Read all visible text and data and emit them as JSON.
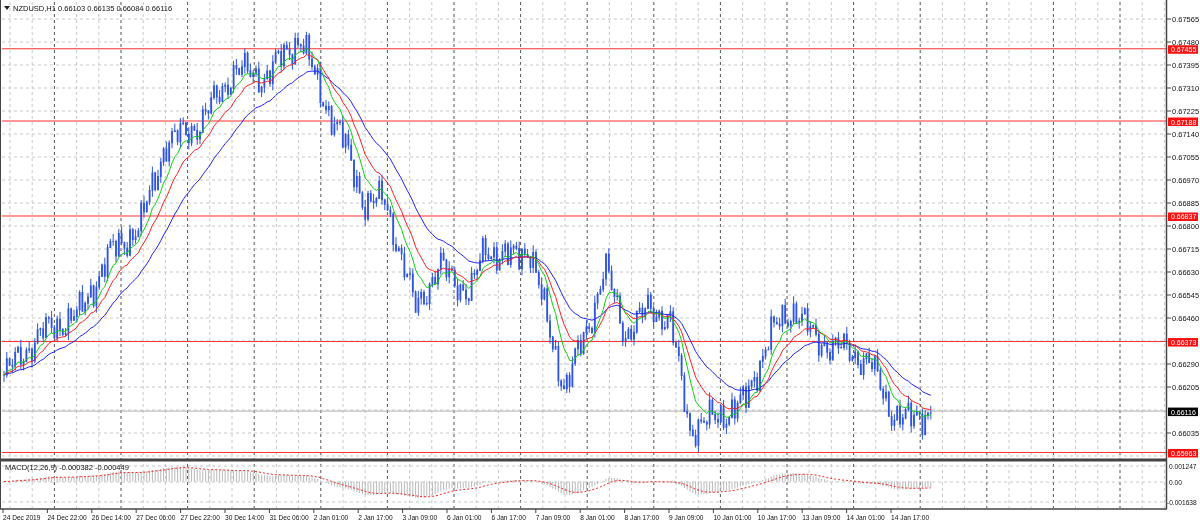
{
  "chart": {
    "symbol": "NZDUSD,H1",
    "ohlc": [
      "0.66103",
      "0.66135",
      "0.66084",
      "0.66116"
    ]
  },
  "price_axis_ticks": [
    "0.67565",
    "0.67480",
    "0.67395",
    "0.67310",
    "0.67225",
    "0.67140",
    "0.67055",
    "0.66970",
    "0.66885",
    "0.66800",
    "0.66715",
    "0.66630",
    "0.66545",
    "0.66460",
    "0.66290",
    "0.66205",
    "0.66035"
  ],
  "price_levels": [
    {
      "label": "0.67455"
    },
    {
      "label": "0.67188"
    },
    {
      "label": "0.66837"
    },
    {
      "label": "0.66373"
    },
    {
      "label": "0.65963"
    }
  ],
  "current_price": "0.66116",
  "time_axis_labels": [
    "24 Dec 2019",
    "24 Dec 22:00",
    "26 Dec 14:00",
    "27 Dec 06:00",
    "27 Dec 22:00",
    "30 Dec 14:00",
    "31 Dec 06:00",
    "2 Jan 01:00",
    "2 Jan 17:00",
    "3 Jan 09:00",
    "6 Jan 01:00",
    "6 Jan 17:00",
    "7 Jan 09:00",
    "8 Jan 01:00",
    "8 Jan 17:00",
    "9 Jan 09:00",
    "10 Jan 01:00",
    "10 Jan 17:00",
    "13 Jan 09:00",
    "14 Jan 01:00",
    "14 Jan 17:00"
  ],
  "macd": {
    "label": "MACD(12,26,9)",
    "values": [
      "-0.000382",
      "-0.000449"
    ],
    "ticks": [
      "0.001247",
      "0.00",
      "-0.001638"
    ]
  }
}
